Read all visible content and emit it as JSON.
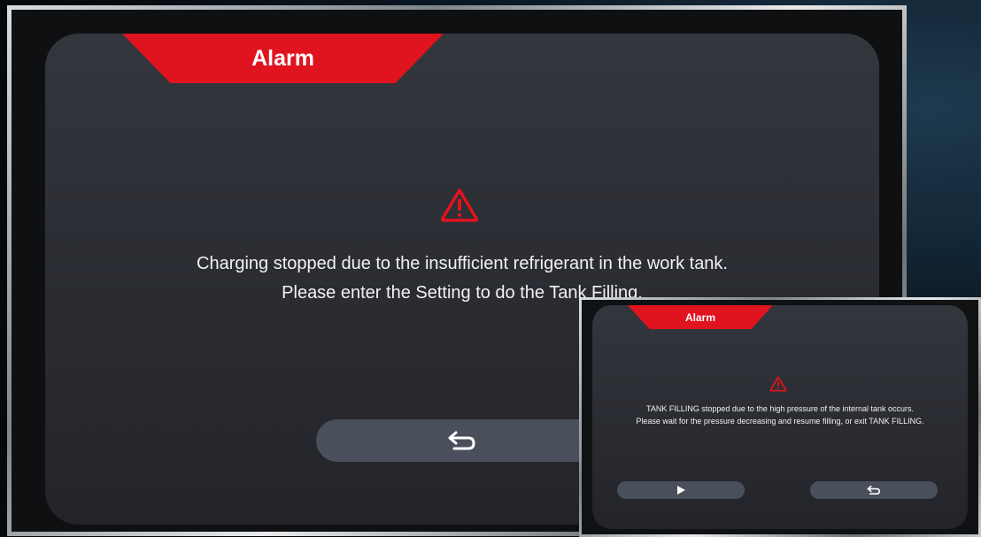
{
  "main_dialog": {
    "title": "Alarm",
    "icon": "warning-triangle-icon",
    "message_line1": "Charging stopped due to the insufficient refrigerant in the work tank.",
    "message_line2": "Please enter the Setting to do the Tank Filling.",
    "back_button_icon": "return-arrow-icon"
  },
  "inset_dialog": {
    "title": "Alarm",
    "icon": "warning-triangle-icon",
    "message_line1": "TANK FILLING stopped due to the high pressure of the internal tank occurs.",
    "message_line2": "Please wait for the pressure decreasing and resume filling, or exit TANK FILLING.",
    "resume_button_icon": "play-icon",
    "exit_button_icon": "return-arrow-icon"
  },
  "colors": {
    "alarm_red": "#e0141e",
    "panel": "#2d3036",
    "button": "#4a4f5c",
    "text": "#f2f2f2"
  }
}
